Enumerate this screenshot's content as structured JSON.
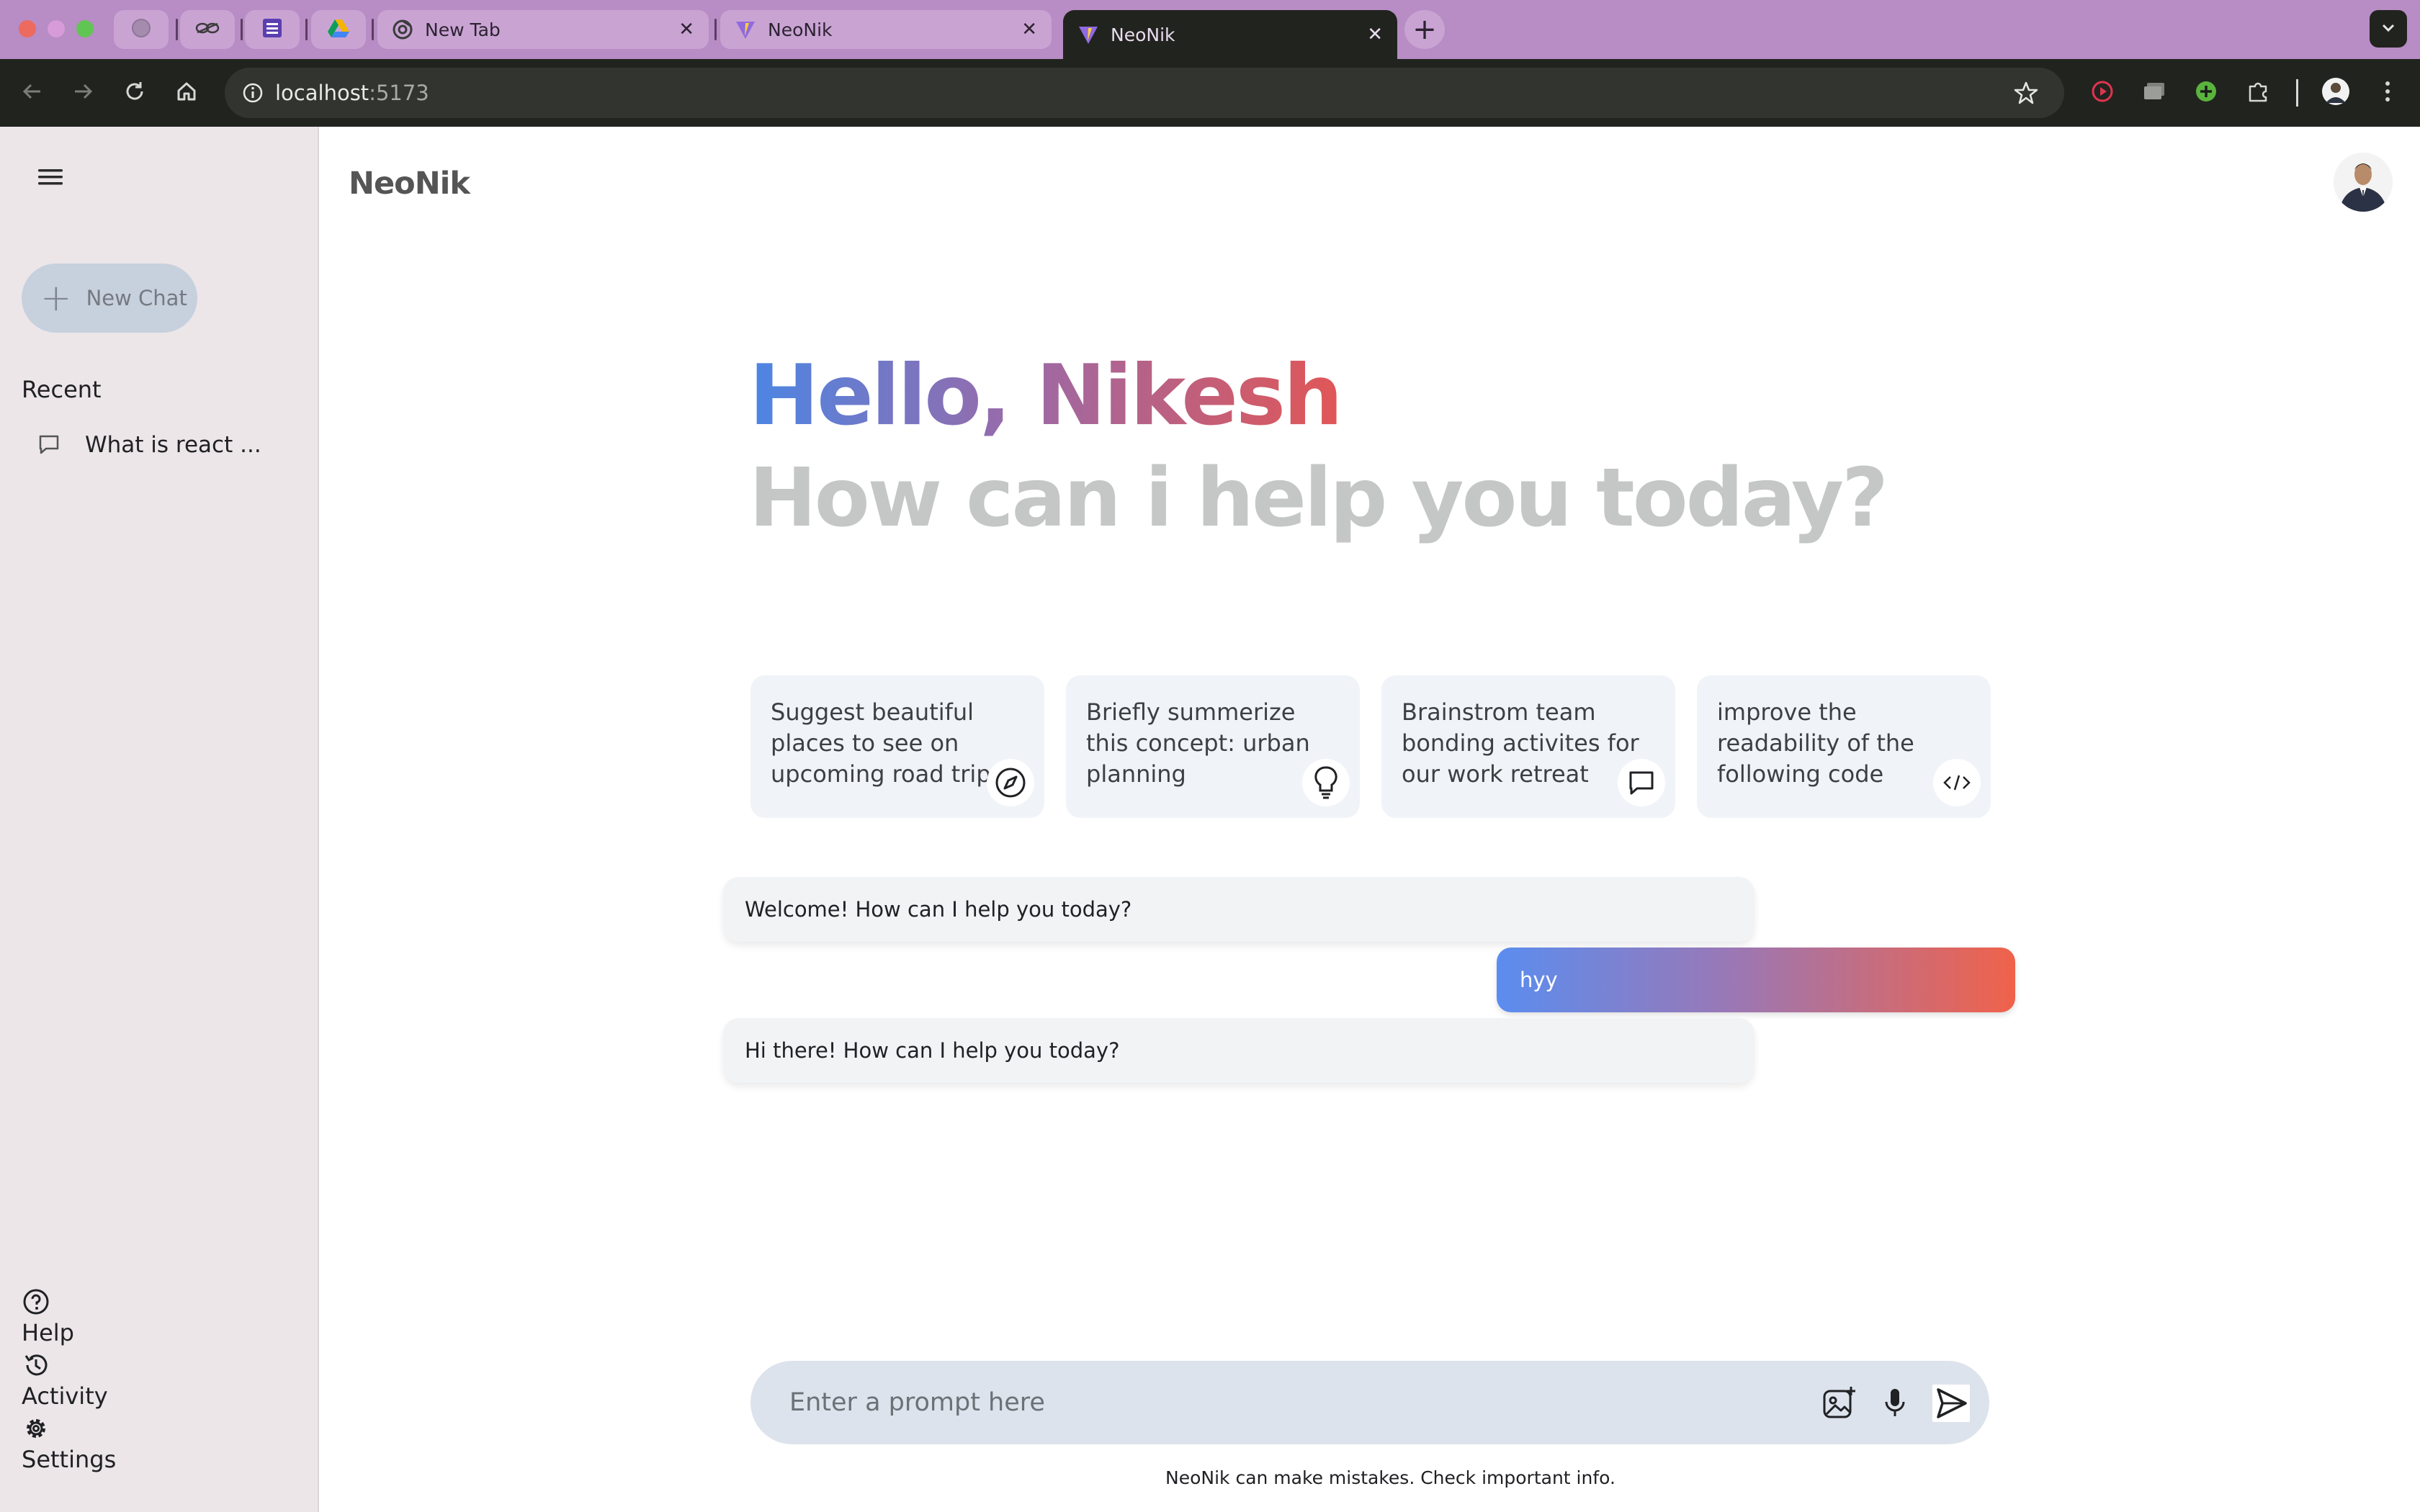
{
  "browser": {
    "tabs": [
      {
        "title": "New Tab",
        "icon": "chrome-icon",
        "active": false
      },
      {
        "title": "NeoNik",
        "icon": "vite-icon",
        "active": false
      },
      {
        "title": "NeoNik",
        "icon": "vite-icon",
        "active": true
      }
    ],
    "pinned_tabs": [
      "globe-icon",
      "link-icon",
      "sheets-icon",
      "drive-icon"
    ],
    "url_host": "localhost",
    "url_port": ":5173"
  },
  "sidebar": {
    "new_chat_label": "New Chat",
    "recent_label": "Recent",
    "recent_items": [
      {
        "label": "What is react ..."
      }
    ],
    "bottom": {
      "help": "Help",
      "activity": "Activity",
      "settings": "Settings"
    }
  },
  "header": {
    "app_name": "NeoNik"
  },
  "greeting": {
    "hello": "Hello, Nikesh",
    "subtitle": "How can i help you today?"
  },
  "cards": [
    {
      "text": "Suggest beautiful places to see on upcoming road trip",
      "icon": "compass-icon"
    },
    {
      "text": "Briefly summerize this concept: urban planning",
      "icon": "bulb-icon"
    },
    {
      "text": "Brainstrom team bonding activites for our work retreat",
      "icon": "message-icon"
    },
    {
      "text": "improve the readability of the following code",
      "icon": "code-icon"
    }
  ],
  "messages": [
    {
      "role": "bot",
      "text": "Welcome! How can I help you today?"
    },
    {
      "role": "user",
      "text": "hyy"
    },
    {
      "role": "bot",
      "text": "Hi there! How can I help you today?"
    }
  ],
  "prompt": {
    "placeholder": "Enter a prompt here",
    "value": ""
  },
  "disclaimer": "NeoNik can make mistakes. Check important info.",
  "colors": {
    "greeting_gradient": [
      "#4b86e4",
      "#9a6aa8",
      "#e15656"
    ],
    "sidebar_bg": "#ece6e9",
    "tabbar_bg": "#b88cc4"
  }
}
